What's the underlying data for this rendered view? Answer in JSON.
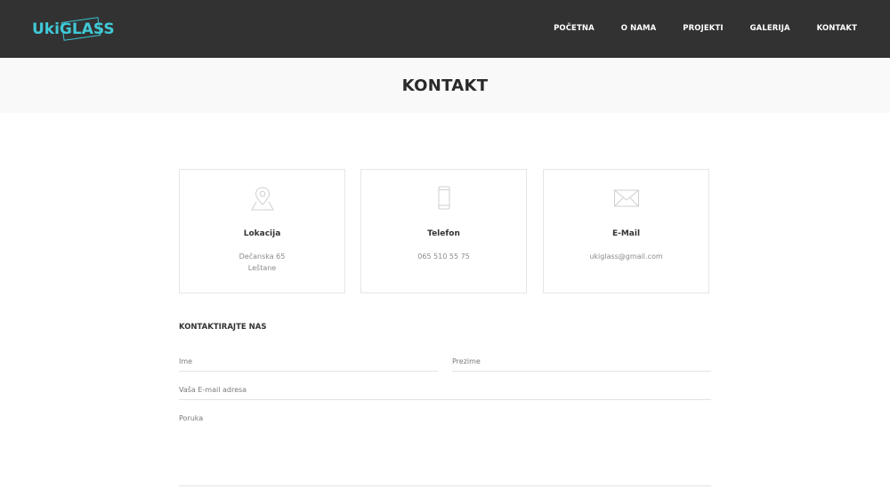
{
  "header": {
    "logo_text": "UkiGLASS",
    "nav": [
      {
        "label": "POČETNA"
      },
      {
        "label": "O NAMA"
      },
      {
        "label": "PROJEKTI"
      },
      {
        "label": "GALERIJA"
      },
      {
        "label": "KONTAKT"
      }
    ]
  },
  "page": {
    "title": "KONTAKT"
  },
  "cards": [
    {
      "icon": "map-pin-icon",
      "title": "Lokacija",
      "line1": "Dečanska 65",
      "line2": "Leštane"
    },
    {
      "icon": "phone-icon",
      "title": "Telefon",
      "line1": "065 510 55 75",
      "line2": ""
    },
    {
      "icon": "envelope-icon",
      "title": "E-Mail",
      "line1": "ukiglass@gmail.com",
      "line2": ""
    }
  ],
  "form": {
    "heading": "KONTAKTIRAJTE NAS",
    "first_name_placeholder": "Ime",
    "last_name_placeholder": "Prezime",
    "email_placeholder": "Vaša E-mail adresa",
    "message_placeholder": "Poruka"
  },
  "colors": {
    "header_bg": "#333232",
    "accent": "#3fc9d6",
    "title_band_bg": "#f9f9f9"
  }
}
